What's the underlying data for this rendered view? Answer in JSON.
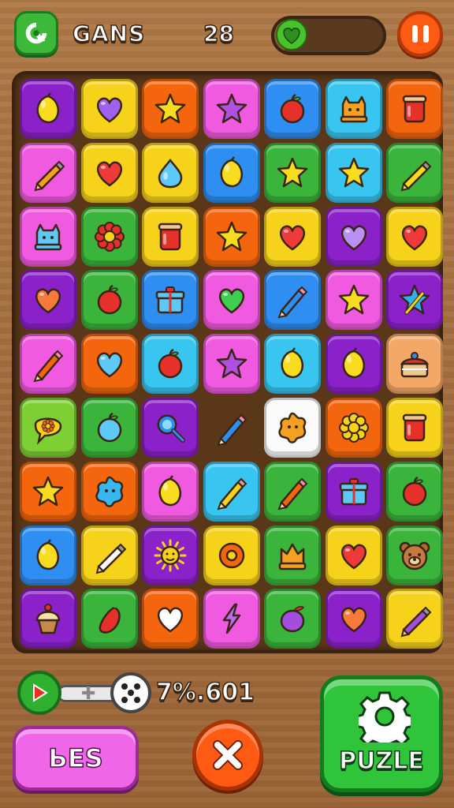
{
  "header": {
    "title": "GANS",
    "score": "28",
    "progress_fraction": 0.1,
    "pause_icon": "pause-icon",
    "logo_icon": "puzzle-badge-icon"
  },
  "colors": {
    "yellow": "#f7d21a",
    "purple": "#8b21c9",
    "orange": "#f4660e",
    "pink": "#f05ae0",
    "blue": "#2f8ef2",
    "cyan": "#38c6f0",
    "green": "#3ab43a",
    "lime": "#7ecf34",
    "red": "#e5312a",
    "peach": "#f4a868",
    "white": "#fafafa"
  },
  "board": {
    "rows": [
      [
        {
          "bg": "purple",
          "icon": "lemon"
        },
        {
          "bg": "yellow",
          "icon": "heart-purple"
        },
        {
          "bg": "orange",
          "icon": "star"
        },
        {
          "bg": "pink",
          "icon": "star-purple"
        },
        {
          "bg": "blue",
          "icon": "apple"
        },
        {
          "bg": "cyan",
          "icon": "cat-block"
        },
        {
          "bg": "orange",
          "icon": "jar"
        }
      ],
      [
        {
          "bg": "pink",
          "icon": "crayon"
        },
        {
          "bg": "yellow",
          "icon": "heart-red"
        },
        {
          "bg": "yellow",
          "icon": "drop-blue"
        },
        {
          "bg": "blue",
          "icon": "lemon"
        },
        {
          "bg": "green",
          "icon": "star"
        },
        {
          "bg": "cyan",
          "icon": "star"
        },
        {
          "bg": "green",
          "icon": "crayon-yellow"
        }
      ],
      [
        {
          "bg": "pink",
          "icon": "cat-block-blue"
        },
        {
          "bg": "green",
          "icon": "flower-red"
        },
        {
          "bg": "yellow",
          "icon": "jar"
        },
        {
          "bg": "orange",
          "icon": "star"
        },
        {
          "bg": "yellow",
          "icon": "heart-red"
        },
        {
          "bg": "purple",
          "icon": "heart-lavender"
        },
        {
          "bg": "yellow",
          "icon": "heart-red"
        }
      ],
      [
        {
          "bg": "purple",
          "icon": "heart-orange"
        },
        {
          "bg": "green",
          "icon": "apple"
        },
        {
          "bg": "blue",
          "icon": "box-blue"
        },
        {
          "bg": "pink",
          "icon": "heart-green"
        },
        {
          "bg": "blue",
          "icon": "pencil-blue"
        },
        {
          "bg": "pink",
          "icon": "star"
        },
        {
          "bg": "purple",
          "icon": "star-wand"
        }
      ],
      [
        {
          "bg": "pink",
          "icon": "pencil-orange"
        },
        {
          "bg": "orange",
          "icon": "heart-blue"
        },
        {
          "bg": "cyan",
          "icon": "apple"
        },
        {
          "bg": "pink",
          "icon": "star-purple"
        },
        {
          "bg": "cyan",
          "icon": "lemon"
        },
        {
          "bg": "purple",
          "icon": "lemon"
        },
        {
          "bg": "peach",
          "icon": "cake"
        }
      ],
      [
        {
          "bg": "lime",
          "icon": "bubble-flower"
        },
        {
          "bg": "green",
          "icon": "apple-blue"
        },
        {
          "bg": "purple",
          "icon": "magnifier"
        },
        {
          "bg": "none",
          "icon": "pencil-blue"
        },
        {
          "bg": "white",
          "icon": "splat-orange"
        },
        {
          "bg": "orange",
          "icon": "flower-yellow"
        },
        {
          "bg": "yellow",
          "icon": "jar"
        }
      ],
      [
        {
          "bg": "orange",
          "icon": "star"
        },
        {
          "bg": "orange",
          "icon": "splat-blue"
        },
        {
          "bg": "pink",
          "icon": "lemon"
        },
        {
          "bg": "cyan",
          "icon": "pencil-yellow"
        },
        {
          "bg": "green",
          "icon": "pencil-orange"
        },
        {
          "bg": "purple",
          "icon": "box-blue"
        },
        {
          "bg": "green",
          "icon": "apple"
        }
      ],
      [
        {
          "bg": "blue",
          "icon": "lemon"
        },
        {
          "bg": "yellow",
          "icon": "crayon-green"
        },
        {
          "bg": "purple",
          "icon": "sun"
        },
        {
          "bg": "yellow",
          "icon": "ring-orange"
        },
        {
          "bg": "green",
          "icon": "crown-block"
        },
        {
          "bg": "yellow",
          "icon": "heart-red"
        },
        {
          "bg": "green",
          "icon": "bear"
        }
      ],
      [
        {
          "bg": "purple",
          "icon": "cupcake"
        },
        {
          "bg": "green",
          "icon": "pepper"
        },
        {
          "bg": "orange",
          "icon": "heart-white"
        },
        {
          "bg": "pink",
          "icon": "bolt"
        },
        {
          "bg": "green",
          "icon": "plum"
        },
        {
          "bg": "purple",
          "icon": "heart-orange"
        },
        {
          "bg": "yellow",
          "icon": "crayon-purple"
        }
      ]
    ]
  },
  "bottom": {
    "value_text": "7%.601",
    "left_button_label": "ЬES",
    "right_button_label": "PUZLE",
    "play_icon": "play-icon",
    "slider_icon": "plus-icon",
    "dice_icon": "dice-icon",
    "close_icon": "close-icon",
    "gear_icon": "gear-icon"
  }
}
